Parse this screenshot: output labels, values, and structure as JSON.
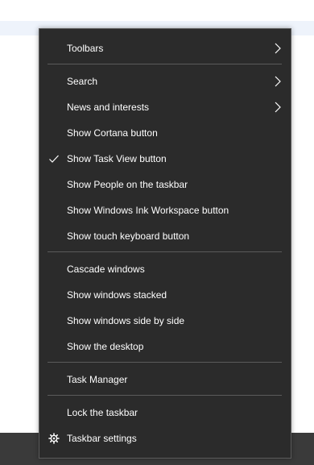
{
  "menu": {
    "items": [
      {
        "label": "Toolbars",
        "submenu": true
      },
      {
        "label": "Search",
        "submenu": true
      },
      {
        "label": "News and interests",
        "submenu": true
      },
      {
        "label": "Show Cortana button"
      },
      {
        "label": "Show Task View button",
        "checked": true
      },
      {
        "label": "Show People on the taskbar"
      },
      {
        "label": "Show Windows Ink Workspace button"
      },
      {
        "label": "Show touch keyboard button"
      },
      {
        "label": "Cascade windows"
      },
      {
        "label": "Show windows stacked"
      },
      {
        "label": "Show windows side by side"
      },
      {
        "label": "Show the desktop"
      },
      {
        "label": "Task Manager"
      },
      {
        "label": "Lock the taskbar"
      },
      {
        "label": "Taskbar settings",
        "icon": "gear-icon"
      }
    ]
  },
  "colors": {
    "menu_background": "#2b2b2b",
    "menu_text": "#ffffff",
    "separator": "#5b5b5b",
    "taskbar": "#3a3a3a"
  }
}
